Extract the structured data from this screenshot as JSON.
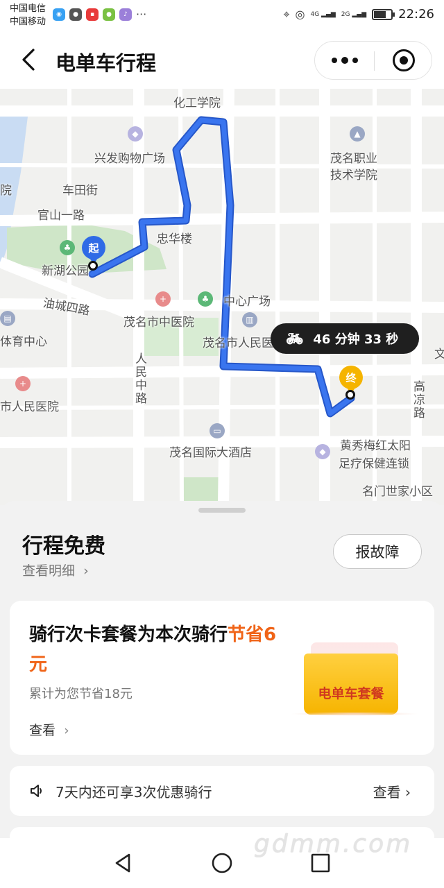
{
  "status_bar": {
    "carrier_1": "中国电信",
    "carrier_2": "中国移动",
    "time": "22:26",
    "net_1": "4G",
    "net_2": "2G",
    "battery_level": 0.7
  },
  "nav": {
    "title": "电单车行程"
  },
  "map": {
    "labels": {
      "huagong": "化工学院",
      "xingfa": "兴发购物广场",
      "maoming_vocational_1": "茂名职业",
      "maoming_vocational_2": "技术学院",
      "chetian": "车田街",
      "guanshan": "官山一路",
      "zhonghua": "忠华楼",
      "xinhu": "新湖公园",
      "youcheng": "油城四路",
      "center_square": "中心广场",
      "tcm": "茂名市中医院",
      "peoples_1": "茂名市人民医院",
      "sports": "体育中心",
      "renmin_road": "人民中路",
      "gaoliang_road": "高凉路",
      "city_hospital": "市人民医院",
      "hotel": "茂名国际大酒店",
      "spa_1": "黄秀梅红太阳",
      "spa_2": "足疗保健连锁",
      "mingmen": "名门世家小区",
      "edge_yuan": "院",
      "edge_wen": "文"
    },
    "start_marker": "起",
    "end_marker": "终",
    "duration": {
      "icon": "bike-icon",
      "text": "46 分钟 33 秒"
    },
    "route_color": "#2f6be6"
  },
  "sheet": {
    "trip_title": "行程免费",
    "detail_link": "查看明细",
    "report_button": "报故障",
    "package_card": {
      "headline_prefix": "骑行次卡套餐为本次骑行",
      "headline_highlight": "节省6元",
      "subtext": "累计为您节省18元",
      "view_label": "查看",
      "art_label": "电单车套餐"
    },
    "promo": {
      "text": "7天内还可享3次优惠骑行",
      "view_label": "查看"
    }
  },
  "watermark": "gdmm.com",
  "colors": {
    "accent_orange": "#f06418",
    "route_blue": "#2f6be6",
    "start_blue": "#2f6be6",
    "end_yellow": "#f5b400"
  }
}
